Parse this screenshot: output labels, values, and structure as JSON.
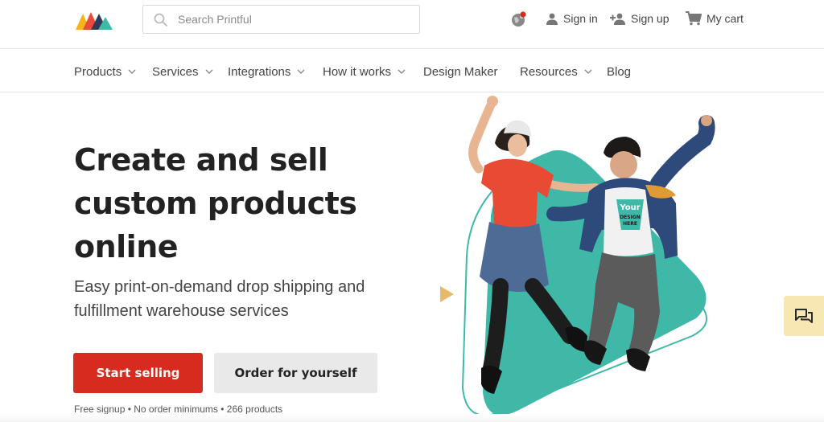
{
  "header": {
    "logo_icon": "printful-logo-icon",
    "search": {
      "placeholder": "Search Printful",
      "value": ""
    },
    "globe_icon": "globe-icon",
    "sign_in": "Sign in",
    "sign_up": "Sign up",
    "cart": "My cart"
  },
  "nav": {
    "items": [
      {
        "label": "Products",
        "has_dropdown": true
      },
      {
        "label": "Services",
        "has_dropdown": true
      },
      {
        "label": "Integrations",
        "has_dropdown": true
      },
      {
        "label": "How it works",
        "has_dropdown": true
      },
      {
        "label": "Design Maker",
        "has_dropdown": false
      },
      {
        "label": "Resources",
        "has_dropdown": true
      },
      {
        "label": "Blog",
        "has_dropdown": false
      }
    ]
  },
  "hero": {
    "title": "Create and sell custom products online",
    "subtitle": "Easy print-on-demand drop shipping and fulfillment warehouse services",
    "primary_cta": "Start selling",
    "secondary_cta": "Order for yourself",
    "fineprint": "Free signup • No order minimums • 266 products",
    "shirt_print": [
      "Your",
      "DESIGN",
      "HERE"
    ]
  },
  "colors": {
    "primary": "#d72b1f",
    "teal": "#3fb8a8",
    "chat_bg": "#f7e7b2",
    "badge": "#d72b1f"
  }
}
